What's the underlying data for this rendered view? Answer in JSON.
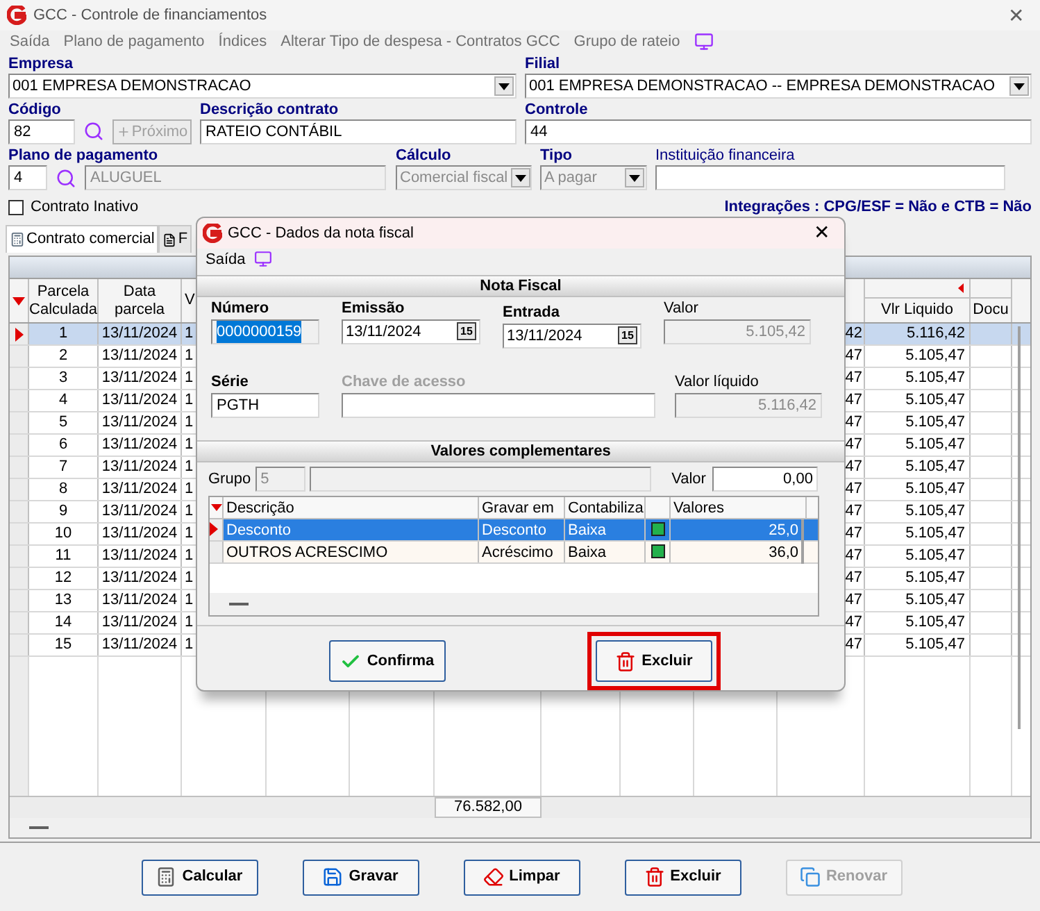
{
  "window": {
    "title": "GCC - Controle de financiamentos",
    "close": "✕"
  },
  "menu": [
    {
      "label": "Saída"
    },
    {
      "label": "Plano de pagamento"
    },
    {
      "label": "Índices"
    },
    {
      "label": "Alterar Tipo de despesa - Contratos GCC"
    },
    {
      "label": "Grupo de rateio"
    }
  ],
  "form": {
    "empresa": {
      "label": "Empresa",
      "value": "001 EMPRESA DEMONSTRACAO"
    },
    "filial": {
      "label": "Filial",
      "value": "001 EMPRESA DEMONSTRACAO -- EMPRESA DEMONSTRACAO"
    },
    "codigo": {
      "label": "Código",
      "value": "82"
    },
    "proximo": {
      "label": "Próximo",
      "disabled": true
    },
    "descricao": {
      "label": "Descrição contrato",
      "value": "RATEIO CONTÁBIL"
    },
    "controle": {
      "label": "Controle",
      "value": "44"
    },
    "plano": {
      "label": "Plano de pagamento",
      "value": "4",
      "name": "ALUGUEL"
    },
    "calculo": {
      "label": "Cálculo",
      "value": "Comercial fiscal",
      "disabled": true
    },
    "tipo": {
      "label": "Tipo",
      "value": "A pagar",
      "disabled": true
    },
    "instituicao": {
      "label": "Instituição financeira"
    },
    "inativo": {
      "label": "Contrato Inativo",
      "checked": false
    },
    "integracoes": "Integrações : CPG/ESF = Não e CTB = Não"
  },
  "tabs": [
    {
      "label": "Contrato comercial",
      "selected": true
    },
    {
      "label": "F",
      "selected": false
    }
  ],
  "table": {
    "columns": [
      "Parcela Calculada",
      "Data parcela",
      "V",
      null,
      "Vlr Liquido",
      "Docu"
    ],
    "rows": [
      {
        "cells": [
          "1",
          "13/11/2024",
          "1",
          "42",
          "5.116,42"
        ],
        "selected": true
      },
      {
        "cells": [
          "2",
          "13/11/2024",
          "1",
          "47",
          "5.105,47"
        ],
        "selected": false
      },
      {
        "cells": [
          "3",
          "13/11/2024",
          "1",
          "47",
          "5.105,47"
        ],
        "selected": false
      },
      {
        "cells": [
          "4",
          "13/11/2024",
          "1",
          "47",
          "5.105,47"
        ],
        "selected": false
      },
      {
        "cells": [
          "5",
          "13/11/2024",
          "1",
          "47",
          "5.105,47"
        ],
        "selected": false
      },
      {
        "cells": [
          "6",
          "13/11/2024",
          "1",
          "47",
          "5.105,47"
        ],
        "selected": false
      },
      {
        "cells": [
          "7",
          "13/11/2024",
          "1",
          "47",
          "5.105,47"
        ],
        "selected": false
      },
      {
        "cells": [
          "8",
          "13/11/2024",
          "1",
          "47",
          "5.105,47"
        ],
        "selected": false
      },
      {
        "cells": [
          "9",
          "13/11/2024",
          "1",
          "47",
          "5.105,47"
        ],
        "selected": false
      },
      {
        "cells": [
          "10",
          "13/11/2024",
          "1",
          "47",
          "5.105,47"
        ],
        "selected": false
      },
      {
        "cells": [
          "11",
          "13/11/2024",
          "1",
          "47",
          "5.105,47"
        ],
        "selected": false
      },
      {
        "cells": [
          "12",
          "13/11/2024",
          "1",
          "47",
          "5.105,47"
        ],
        "selected": false
      },
      {
        "cells": [
          "13",
          "13/11/2024",
          "1",
          "47",
          "5.105,47"
        ],
        "selected": false
      },
      {
        "cells": [
          "14",
          "13/11/2024",
          "1",
          "47",
          "5.105,47"
        ],
        "selected": false
      },
      {
        "cells": [
          "15",
          "13/11/2024",
          "1",
          "47",
          "5.105,47"
        ],
        "selected": false
      }
    ],
    "total": "76.582,00"
  },
  "buttons": [
    {
      "label": "Calcular",
      "disabled": false
    },
    {
      "label": "Gravar",
      "disabled": false
    },
    {
      "label": "Limpar",
      "disabled": false
    },
    {
      "label": "Excluir",
      "disabled": false
    },
    {
      "label": "Renovar",
      "disabled": true
    }
  ],
  "dialog": {
    "title": "GCC - Dados da nota fiscal",
    "close": "✕",
    "menu": [
      {
        "label": "Saída"
      }
    ],
    "section_1": "Nota Fiscal",
    "numero": {
      "label": "Número",
      "value": "0000000159",
      "text_selected": true
    },
    "emissao": {
      "label": "Emissão",
      "value": "13/11/2024",
      "calendar": "15"
    },
    "entrada": {
      "label": "Entrada",
      "value": "13/11/2024",
      "calendar": "15"
    },
    "valor": {
      "label": "Valor",
      "value": "5.105,42"
    },
    "serie": {
      "label": "Série",
      "value": "PGTH"
    },
    "chave": {
      "label": "Chave de acesso",
      "disabled": true
    },
    "valor_liquido": {
      "label": "Valor líquido",
      "value": "5.116,42"
    },
    "section_2": "Valores complementares",
    "grupo": {
      "label": "Grupo",
      "value": "5"
    },
    "valor_comp": {
      "label": "Valor",
      "value": "0,00"
    },
    "grid": {
      "columns": [
        {
          "label": "Descrição"
        },
        {
          "label": "Gravar em"
        },
        {
          "label": "Contabiliza"
        },
        {
          "label": "Valores"
        }
      ],
      "rows": [
        {
          "descricao": "Desconto",
          "gravar": "Desconto",
          "contabiliza": "Baixa",
          "checked": true,
          "valor": "25,0",
          "selected": true
        },
        {
          "descricao": "OUTROS ACRESCIMO",
          "gravar": "Acréscimo",
          "contabiliza": "Baixa",
          "checked": true,
          "valor": "36,0",
          "selected": false
        }
      ]
    },
    "buttons": [
      {
        "label": "Confirma",
        "highlighted": false
      },
      {
        "label": "Excluir",
        "highlighted": true
      }
    ]
  }
}
